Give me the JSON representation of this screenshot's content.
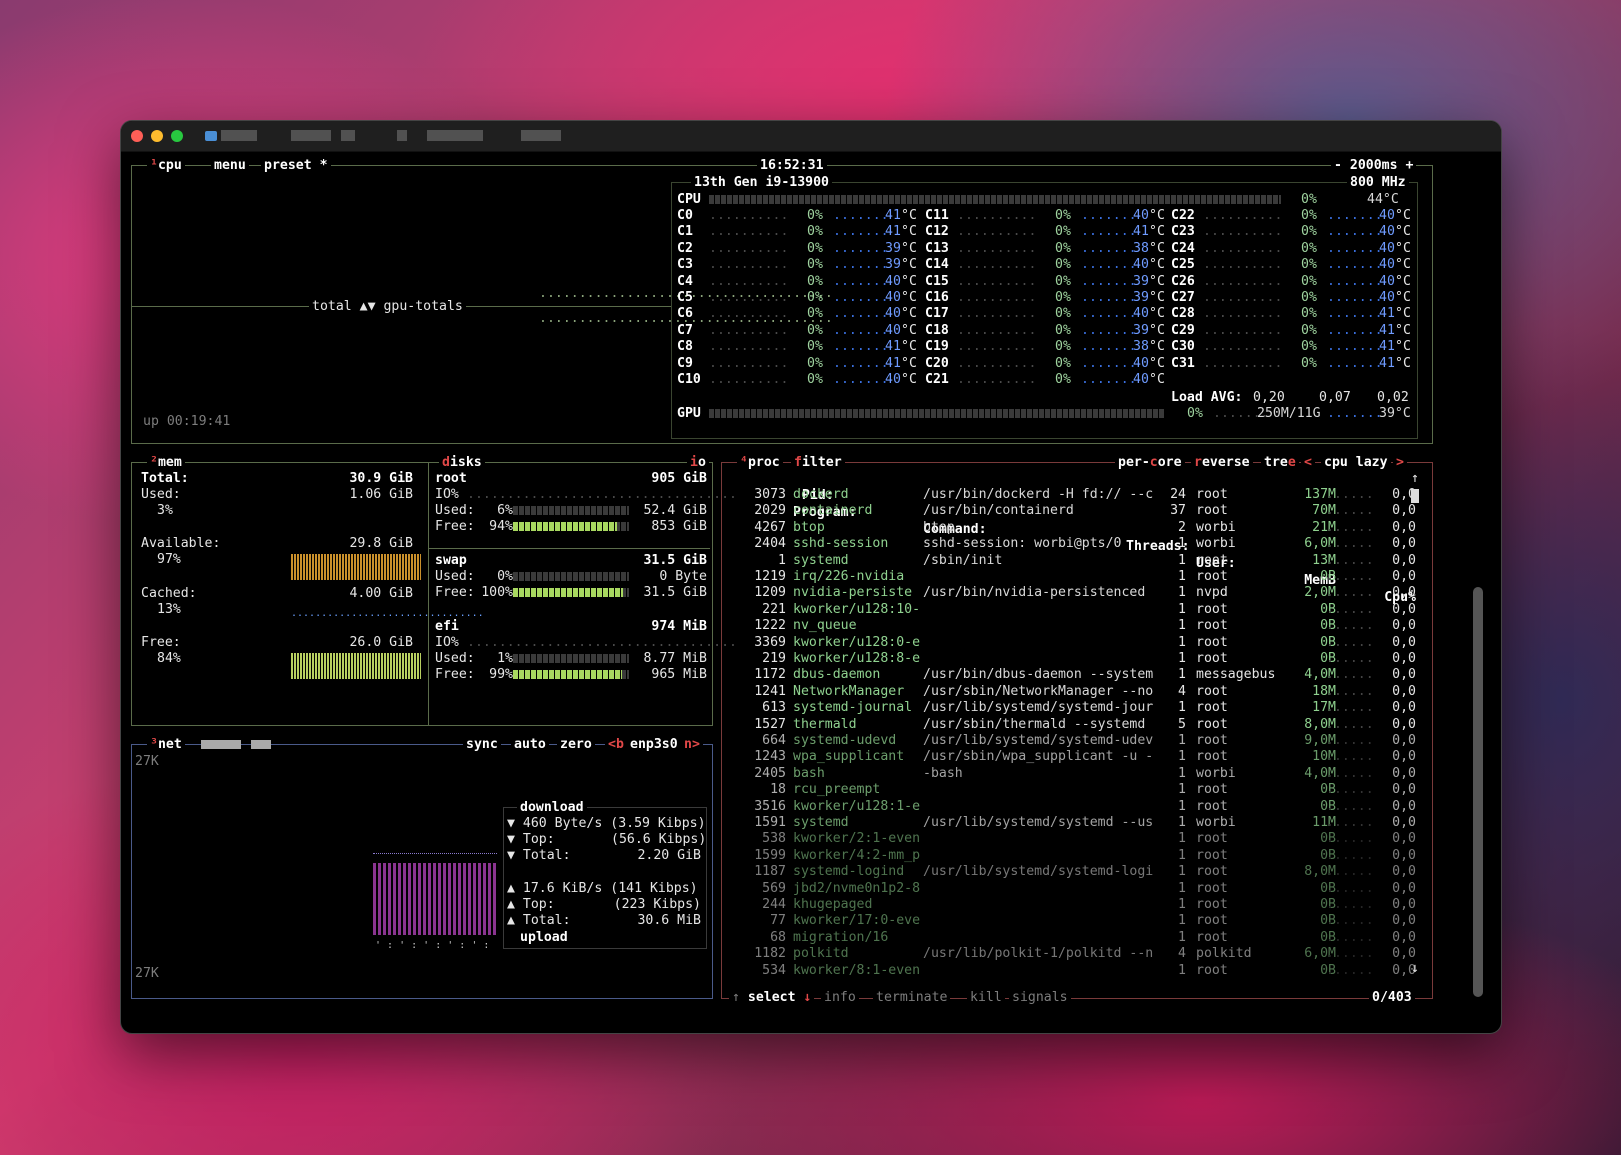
{
  "window": {
    "title": ""
  },
  "cpu": {
    "tab_cpu": "cpu",
    "tab_menu": "menu",
    "tab_preset": "preset *",
    "clock": "16:52:31",
    "interval": "- 2000ms +",
    "model": "13th Gen i9-13900",
    "freq": "800 MHz",
    "graph_label": "total ▲▼ gpu-totals",
    "uptime": "up 00:19:41",
    "total_label": "CPU",
    "total_pct": "0%",
    "total_temp": "44°C",
    "cores": [
      {
        "n": "C0",
        "p": "0%",
        "t": "41"
      },
      {
        "n": "C1",
        "p": "0%",
        "t": "41"
      },
      {
        "n": "C2",
        "p": "0%",
        "t": "39"
      },
      {
        "n": "C3",
        "p": "0%",
        "t": "39"
      },
      {
        "n": "C4",
        "p": "0%",
        "t": "40"
      },
      {
        "n": "C5",
        "p": "0%",
        "t": "40"
      },
      {
        "n": "C6",
        "p": "0%",
        "t": "40"
      },
      {
        "n": "C7",
        "p": "0%",
        "t": "40"
      },
      {
        "n": "C8",
        "p": "0%",
        "t": "41"
      },
      {
        "n": "C9",
        "p": "0%",
        "t": "41"
      },
      {
        "n": "C10",
        "p": "0%",
        "t": "40"
      },
      {
        "n": "C11",
        "p": "0%",
        "t": "40"
      },
      {
        "n": "C12",
        "p": "0%",
        "t": "41"
      },
      {
        "n": "C13",
        "p": "0%",
        "t": "38"
      },
      {
        "n": "C14",
        "p": "0%",
        "t": "40"
      },
      {
        "n": "C15",
        "p": "0%",
        "t": "39"
      },
      {
        "n": "C16",
        "p": "0%",
        "t": "39"
      },
      {
        "n": "C17",
        "p": "0%",
        "t": "40"
      },
      {
        "n": "C18",
        "p": "0%",
        "t": "39"
      },
      {
        "n": "C19",
        "p": "0%",
        "t": "38"
      },
      {
        "n": "C20",
        "p": "0%",
        "t": "40"
      },
      {
        "n": "C21",
        "p": "0%",
        "t": "40"
      },
      {
        "n": "C22",
        "p": "0%",
        "t": "40"
      },
      {
        "n": "C23",
        "p": "0%",
        "t": "40"
      },
      {
        "n": "C24",
        "p": "0%",
        "t": "40"
      },
      {
        "n": "C25",
        "p": "0%",
        "t": "40"
      },
      {
        "n": "C26",
        "p": "0%",
        "t": "40"
      },
      {
        "n": "C27",
        "p": "0%",
        "t": "40"
      },
      {
        "n": "C28",
        "p": "0%",
        "t": "41"
      },
      {
        "n": "C29",
        "p": "0%",
        "t": "41"
      },
      {
        "n": "C30",
        "p": "0%",
        "t": "41"
      },
      {
        "n": "C31",
        "p": "0%",
        "t": "41"
      }
    ],
    "temp_unit": "°C",
    "load_label": "Load AVG:",
    "load": [
      "0,20",
      "0,07",
      "0,02"
    ],
    "gpu_label": "GPU",
    "gpu_pct": "0%",
    "gpu_mem": "250M/11G",
    "gpu_temp": "39°C"
  },
  "mem": {
    "tab": "mem",
    "total_label": "Total:",
    "total": "30.9 GiB",
    "used_label": "Used:",
    "used": "1.06 GiB",
    "used_pct": "3%",
    "avail_label": "Available:",
    "avail": "29.8 GiB",
    "avail_pct": "97%",
    "cached_label": "Cached:",
    "cached": "4.00 GiB",
    "cached_pct": "13%",
    "free_label": "Free:",
    "free": "26.0 GiB",
    "free_pct": "84%"
  },
  "disks": {
    "tab": "disks",
    "io_tab": "io",
    "items": [
      {
        "name": "root",
        "size": "905 GiB",
        "io": "IO%",
        "used_pct": "6%",
        "used_val": "52.4 GiB",
        "free_pct": "94%",
        "free_val": "853 GiB",
        "used_frac": 0.06
      },
      {
        "name": "swap",
        "size": "31.5 GiB",
        "io": "",
        "used_pct": "0%",
        "used_val": "0 Byte",
        "free_pct": "100%",
        "free_val": "31.5 GiB",
        "used_frac": 0.0
      },
      {
        "name": "efi",
        "size": "974 MiB",
        "io": "IO%",
        "used_pct": "1%",
        "used_val": "8.77 MiB",
        "free_pct": "99%",
        "free_val": "965 MiB",
        "used_frac": 0.01
      }
    ],
    "used_label": "Used:",
    "free_label": "Free:"
  },
  "net": {
    "tab": "net",
    "sync": "sync",
    "auto": "auto",
    "zero": "zero",
    "prev": "<b",
    "iface": "enp3s0",
    "next": "n>",
    "scale_top": "27K",
    "scale_bottom": "27K",
    "download_label": "download",
    "upload_label": "upload",
    "dl_rate": "460 Byte/s",
    "dl_rate_bits": "(3.59 Kibps)",
    "dl_top_label": "Top:",
    "dl_top": "(56.6 Kibps)",
    "dl_total_label": "Total:",
    "dl_total": "2.20 GiB",
    "ul_rate": "17.6 KiB/s",
    "ul_rate_bits": "(141 Kibps)",
    "ul_top_label": "Top:",
    "ul_top": "(223 Kibps)",
    "ul_total_label": "Total:",
    "ul_total": "30.6 MiB"
  },
  "proc": {
    "tab": "proc",
    "filter": "filter",
    "per_core": "per-core",
    "reverse": "reverse",
    "tree": "tree",
    "sort_prev": "<",
    "sort": "cpu lazy",
    "sort_next": ">",
    "headers": {
      "pid": "Pid:",
      "program": "Program:",
      "command": "Command:",
      "threads": "Threads:",
      "user": "User:",
      "mem": "MemB",
      "cpu": "Cpu%"
    },
    "rows": [
      {
        "pid": "3073",
        "prog": "dockerd",
        "cmd": "/usr/bin/dockerd -H fd:// --c",
        "thr": "24",
        "user": "root",
        "mem": "137M",
        "cpu": "0,0"
      },
      {
        "pid": "2029",
        "prog": "containerd",
        "cmd": "/usr/bin/containerd",
        "thr": "37",
        "user": "root",
        "mem": "70M",
        "cpu": "0,0"
      },
      {
        "pid": "4267",
        "prog": "btop",
        "cmd": "btop",
        "thr": "2",
        "user": "worbi",
        "mem": "21M",
        "cpu": "0,0"
      },
      {
        "pid": "2404",
        "prog": "sshd-session",
        "cmd": "sshd-session: worbi@pts/0",
        "thr": "1",
        "user": "worbi",
        "mem": "6,0M",
        "cpu": "0,0"
      },
      {
        "pid": "1",
        "prog": "systemd",
        "cmd": "/sbin/init",
        "thr": "1",
        "user": "root",
        "mem": "13M",
        "cpu": "0,0"
      },
      {
        "pid": "1219",
        "prog": "irq/226-nvidia",
        "cmd": "",
        "thr": "1",
        "user": "root",
        "mem": "0B",
        "cpu": "0,0"
      },
      {
        "pid": "1209",
        "prog": "nvidia-persiste",
        "cmd": "/usr/bin/nvidia-persistenced",
        "thr": "1",
        "user": "nvpd",
        "mem": "2,0M",
        "cpu": "0,0"
      },
      {
        "pid": "221",
        "prog": "kworker/u128:10-",
        "cmd": "",
        "thr": "1",
        "user": "root",
        "mem": "0B",
        "cpu": "0,0"
      },
      {
        "pid": "1222",
        "prog": "nv_queue",
        "cmd": "",
        "thr": "1",
        "user": "root",
        "mem": "0B",
        "cpu": "0,0"
      },
      {
        "pid": "3369",
        "prog": "kworker/u128:0-e",
        "cmd": "",
        "thr": "1",
        "user": "root",
        "mem": "0B",
        "cpu": "0,0"
      },
      {
        "pid": "219",
        "prog": "kworker/u128:8-e",
        "cmd": "",
        "thr": "1",
        "user": "root",
        "mem": "0B",
        "cpu": "0,0"
      },
      {
        "pid": "1172",
        "prog": "dbus-daemon",
        "cmd": "/usr/bin/dbus-daemon --system",
        "thr": "1",
        "user": "messagebus",
        "mem": "4,0M",
        "cpu": "0,0"
      },
      {
        "pid": "1241",
        "prog": "NetworkManager",
        "cmd": "/usr/sbin/NetworkManager --no",
        "thr": "4",
        "user": "root",
        "mem": "18M",
        "cpu": "0,0"
      },
      {
        "pid": "613",
        "prog": "systemd-journal",
        "cmd": "/usr/lib/systemd/systemd-jour",
        "thr": "1",
        "user": "root",
        "mem": "17M",
        "cpu": "0,0"
      },
      {
        "pid": "1527",
        "prog": "thermald",
        "cmd": "/usr/sbin/thermald --systemd",
        "thr": "5",
        "user": "root",
        "mem": "8,0M",
        "cpu": "0,0"
      },
      {
        "pid": "664",
        "prog": "systemd-udevd",
        "cmd": "/usr/lib/systemd/systemd-udev",
        "thr": "1",
        "user": "root",
        "mem": "9,0M",
        "cpu": "0,0"
      },
      {
        "pid": "1243",
        "prog": "wpa_supplicant",
        "cmd": "/usr/sbin/wpa_supplicant -u -",
        "thr": "1",
        "user": "root",
        "mem": "10M",
        "cpu": "0,0"
      },
      {
        "pid": "2405",
        "prog": "bash",
        "cmd": "-bash",
        "thr": "1",
        "user": "worbi",
        "mem": "4,0M",
        "cpu": "0,0"
      },
      {
        "pid": "18",
        "prog": "rcu_preempt",
        "cmd": "",
        "thr": "1",
        "user": "root",
        "mem": "0B",
        "cpu": "0,0"
      },
      {
        "pid": "3516",
        "prog": "kworker/u128:1-e",
        "cmd": "",
        "thr": "1",
        "user": "root",
        "mem": "0B",
        "cpu": "0,0"
      },
      {
        "pid": "1591",
        "prog": "systemd",
        "cmd": "/usr/lib/systemd/systemd --us",
        "thr": "1",
        "user": "worbi",
        "mem": "11M",
        "cpu": "0,0"
      },
      {
        "pid": "538",
        "prog": "kworker/2:1-even",
        "cmd": "",
        "thr": "1",
        "user": "root",
        "mem": "0B",
        "cpu": "0,0"
      },
      {
        "pid": "1599",
        "prog": "kworker/4:2-mm_p",
        "cmd": "",
        "thr": "1",
        "user": "root",
        "mem": "0B",
        "cpu": "0,0"
      },
      {
        "pid": "1187",
        "prog": "systemd-logind",
        "cmd": "/usr/lib/systemd/systemd-logi",
        "thr": "1",
        "user": "root",
        "mem": "8,0M",
        "cpu": "0,0"
      },
      {
        "pid": "569",
        "prog": "jbd2/nvme0n1p2-8",
        "cmd": "",
        "thr": "1",
        "user": "root",
        "mem": "0B",
        "cpu": "0,0"
      },
      {
        "pid": "244",
        "prog": "khugepaged",
        "cmd": "",
        "thr": "1",
        "user": "root",
        "mem": "0B",
        "cpu": "0,0"
      },
      {
        "pid": "77",
        "prog": "kworker/17:0-eve",
        "cmd": "",
        "thr": "1",
        "user": "root",
        "mem": "0B",
        "cpu": "0,0"
      },
      {
        "pid": "68",
        "prog": "migration/16",
        "cmd": "",
        "thr": "1",
        "user": "root",
        "mem": "0B",
        "cpu": "0,0"
      },
      {
        "pid": "1182",
        "prog": "polkitd",
        "cmd": "/usr/lib/polkit-1/polkitd --n",
        "thr": "4",
        "user": "polkitd",
        "mem": "6,0M",
        "cpu": "0,0"
      },
      {
        "pid": "534",
        "prog": "kworker/8:1-even",
        "cmd": "",
        "thr": "1",
        "user": "root",
        "mem": "0B",
        "cpu": "0,0"
      }
    ],
    "footer": {
      "select": "select",
      "info": "info",
      "terminate": "terminate",
      "kill": "kill",
      "signals": "signals",
      "count": "0/403"
    }
  },
  "colors": {
    "cpu_border": "#5a6b4a",
    "net_border": "#4a5a8a",
    "proc_border": "#7a3a3a",
    "accent": "#e04848"
  }
}
